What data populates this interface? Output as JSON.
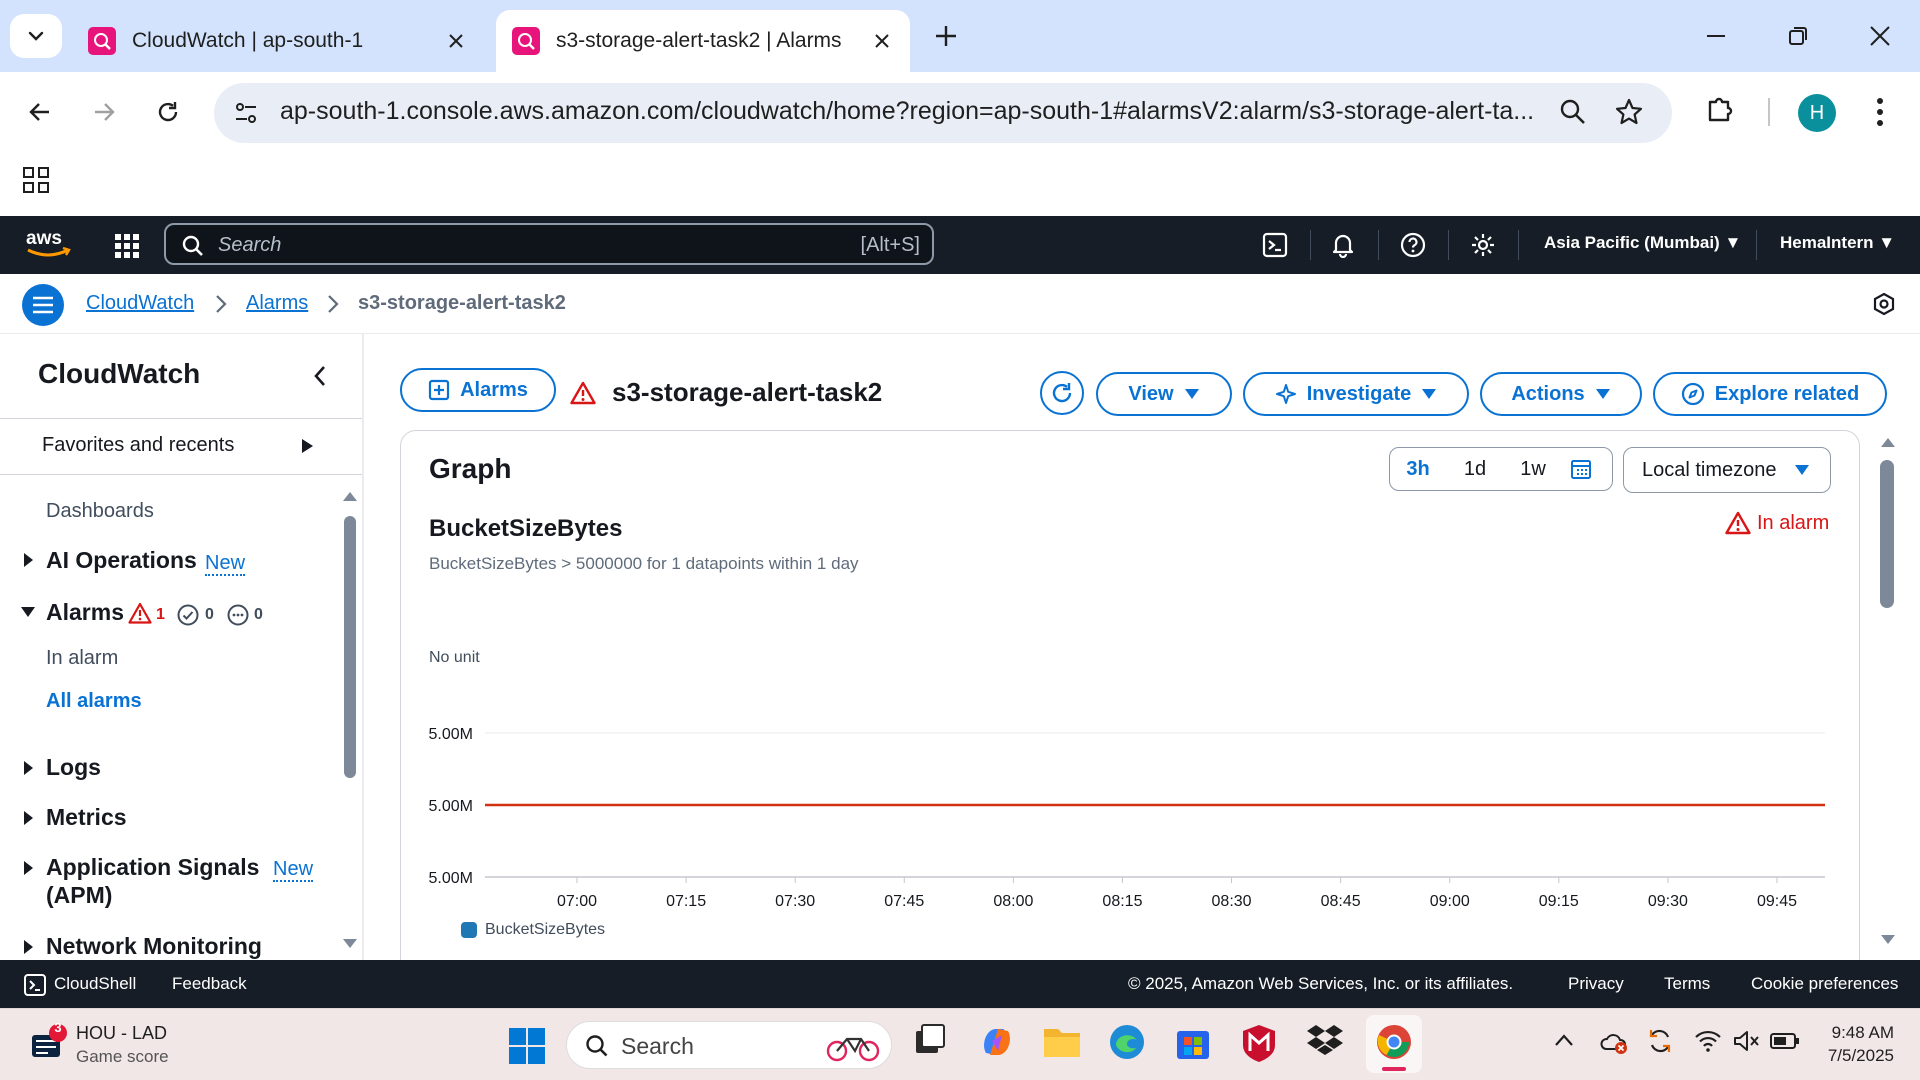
{
  "browser": {
    "tabs": [
      {
        "title": "CloudWatch | ap-south-1",
        "active": false
      },
      {
        "title": "s3-storage-alert-task2 | Alarms",
        "active": true
      }
    ],
    "url": "ap-south-1.console.aws.amazon.com/cloudwatch/home?region=ap-south-1#alarmsV2:alarm/s3-storage-alert-ta...",
    "profile_initial": "H"
  },
  "aws_nav": {
    "search_placeholder": "Search",
    "search_shortcut": "[Alt+S]",
    "region": "Asia Pacific (Mumbai)",
    "user": "HemaIntern"
  },
  "breadcrumb": {
    "items": [
      "CloudWatch",
      "Alarms",
      "s3-storage-alert-task2"
    ]
  },
  "sidenav": {
    "title": "CloudWatch",
    "favorites": "Favorites and recents",
    "dashboards": "Dashboards",
    "ai_operations": "AI Operations",
    "new_badge": "New",
    "alarms": "Alarms",
    "alarm_counts": {
      "in_alarm": "1",
      "ok": "0",
      "insufficient": "0"
    },
    "in_alarm": "In alarm",
    "all_alarms": "All alarms",
    "logs": "Logs",
    "metrics": "Metrics",
    "app_signals_line1": "Application Signals",
    "app_signals_line2": "(APM)",
    "network_monitoring": "Network Monitoring"
  },
  "header": {
    "back_button": "Alarms",
    "title": "s3-storage-alert-task2",
    "view": "View",
    "investigate": "Investigate",
    "actions": "Actions",
    "explore": "Explore related"
  },
  "graph": {
    "panel_title": "Graph",
    "ranges": [
      "3h",
      "1d",
      "1w"
    ],
    "selected_range": "3h",
    "timezone": "Local timezone",
    "metric_name": "BucketSizeBytes",
    "condition": "BucketSizeBytes > 5000000 for 1 datapoints within 1 day",
    "state": "In alarm",
    "unit": "No unit",
    "legend": "BucketSizeBytes"
  },
  "chart_data": {
    "type": "line",
    "ytick_labels": [
      "5.00M",
      "5.00M",
      "5.00M"
    ],
    "x": [
      "07:00",
      "07:15",
      "07:30",
      "07:45",
      "08:00",
      "08:15",
      "08:30",
      "08:45",
      "09:00",
      "09:15",
      "09:30",
      "09:45"
    ],
    "series": [],
    "threshold": {
      "value": 5000000,
      "color": "#d13212"
    },
    "grid": true,
    "legend_position": "bottom-left",
    "colors": {
      "series": "#1f77b4",
      "threshold": "#d13212"
    }
  },
  "footer": {
    "cloudshell": "CloudShell",
    "feedback": "Feedback",
    "copyright": "© 2025, Amazon Web Services, Inc. or its affiliates.",
    "privacy": "Privacy",
    "terms": "Terms",
    "cookies": "Cookie preferences"
  },
  "taskbar": {
    "weather_title": "HOU - LAD",
    "weather_sub": "Game score",
    "notification_count": "3",
    "search_placeholder": "Search",
    "time": "9:48 AM",
    "date": "7/5/2025"
  }
}
